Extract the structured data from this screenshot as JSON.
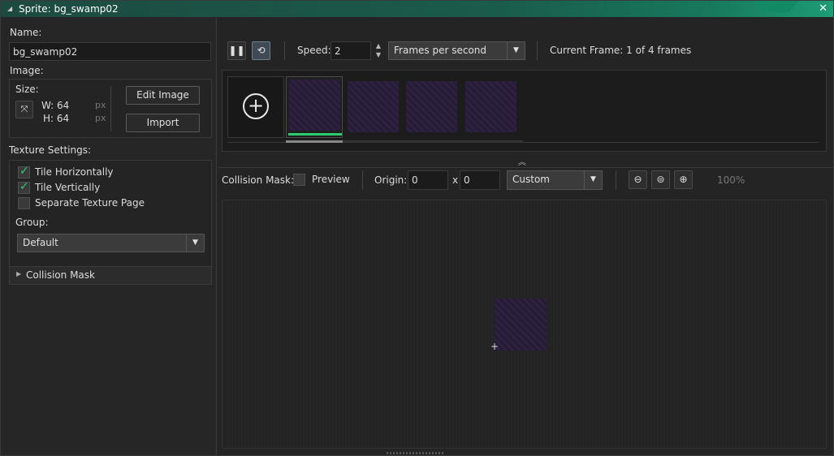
{
  "window": {
    "title": "Sprite: bg_swamp02"
  },
  "left": {
    "name_label": "Name:",
    "name_value": "bg_swamp02",
    "image_label": "Image:",
    "size_label": "Size:",
    "width_text": "W: 64",
    "height_text": "H: 64",
    "px_unit_1": "px",
    "px_unit_2": "px",
    "edit_image_label": "Edit Image",
    "import_label": "Import",
    "texture_settings_label": "Texture Settings:",
    "tile_horizontally_label": "Tile Horizontally",
    "tile_horizontally_checked": true,
    "tile_vertically_label": "Tile Vertically",
    "tile_vertically_checked": true,
    "separate_texture_label": "Separate Texture Page",
    "separate_texture_checked": false,
    "group_label": "Group:",
    "group_value": "Default",
    "collision_mask_section": "Collision Mask"
  },
  "toolbar": {
    "speed_label": "Speed:",
    "speed_value": "2",
    "speed_unit": "Frames per second",
    "current_frame_text": "Current Frame: 1 of 4 frames"
  },
  "frames": {
    "count": 4,
    "selected_index": 0
  },
  "mask_bar": {
    "collision_mask_label": "Collision Mask:",
    "preview_label": "Preview",
    "origin_label": "Origin:",
    "origin_x": "0",
    "x_separator": "x",
    "origin_y": "0",
    "origin_mode": "Custom",
    "zoom_text": "100%"
  },
  "colors": {
    "accent": "#1d9c74",
    "frame_fill": "#2a1e3c",
    "check": "#2ecc71",
    "progress": "#2ecc71"
  }
}
